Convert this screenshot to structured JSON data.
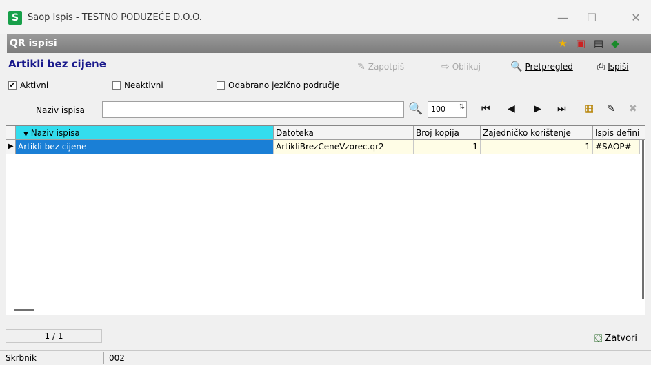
{
  "window": {
    "logo": "S",
    "title": "Saop Ispis - TESTNO PODUZEĆE D.O.O.",
    "min": "—",
    "max": "☐",
    "close": "✕"
  },
  "band": {
    "title": "QR ispisi"
  },
  "toolbar": {
    "form_title": "Artikli bez cijene",
    "sign_label": "Zapotpiš",
    "format_label": "Oblikuj",
    "preview_label": "Pretpregled",
    "print_label": "Ispiši"
  },
  "filters": {
    "active_label": "Aktivni",
    "active_checked": "✔",
    "inactive_label": "Neaktivni",
    "lang_label": "Odabrano jezično područje"
  },
  "search": {
    "label": "Naziv ispisa",
    "value": "",
    "zoom": "100"
  },
  "grid": {
    "columns": [
      "Naziv ispisa",
      "Datoteka",
      "Broj kopija",
      "Zajedničko korištenje",
      "Ispis defini"
    ],
    "sort_arrow": "▼",
    "rows": [
      {
        "naziv": "Artikli bez cijene",
        "datoteka": "ArtikliBrezCeneVzorec.qr2",
        "kopije": "1",
        "zajednicko": "1",
        "ispis": "#SAOP#"
      }
    ]
  },
  "footer": {
    "pager": "1 / 1",
    "close_label": "Zatvori"
  },
  "statusbar": {
    "user": "Skrbnik",
    "code": "002"
  },
  "colors": {
    "header_active": "#33ddee",
    "selected_row": "#1a7fd6",
    "title_blue": "#1a1a8c"
  }
}
